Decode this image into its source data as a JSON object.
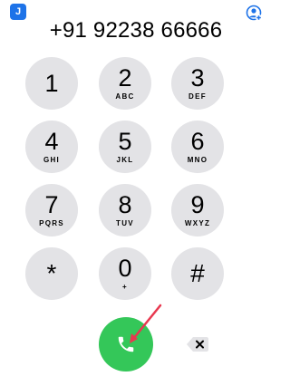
{
  "status": {
    "badge_label": "J",
    "badge_color": "#1e73e8"
  },
  "header": {
    "contact_icon": "add-contact-icon",
    "accent_color": "#1e73e8"
  },
  "dialer": {
    "number": "+91 92238 66666"
  },
  "keypad": {
    "keys": [
      {
        "digit": "1",
        "letters": ""
      },
      {
        "digit": "2",
        "letters": "ABC"
      },
      {
        "digit": "3",
        "letters": "DEF"
      },
      {
        "digit": "4",
        "letters": "GHI"
      },
      {
        "digit": "5",
        "letters": "JKL"
      },
      {
        "digit": "6",
        "letters": "MNO"
      },
      {
        "digit": "7",
        "letters": "PQRS"
      },
      {
        "digit": "8",
        "letters": "TUV"
      },
      {
        "digit": "9",
        "letters": "WXYZ"
      },
      {
        "digit": "*",
        "letters": ""
      },
      {
        "digit": "0",
        "letters": "+"
      },
      {
        "digit": "#",
        "letters": ""
      }
    ],
    "key_color": "#e3e3e6"
  },
  "actions": {
    "call_icon": "phone-icon",
    "call_color": "#34c759",
    "delete_icon": "backspace-icon"
  },
  "annotation": {
    "arrow_color": "#e8384f"
  }
}
